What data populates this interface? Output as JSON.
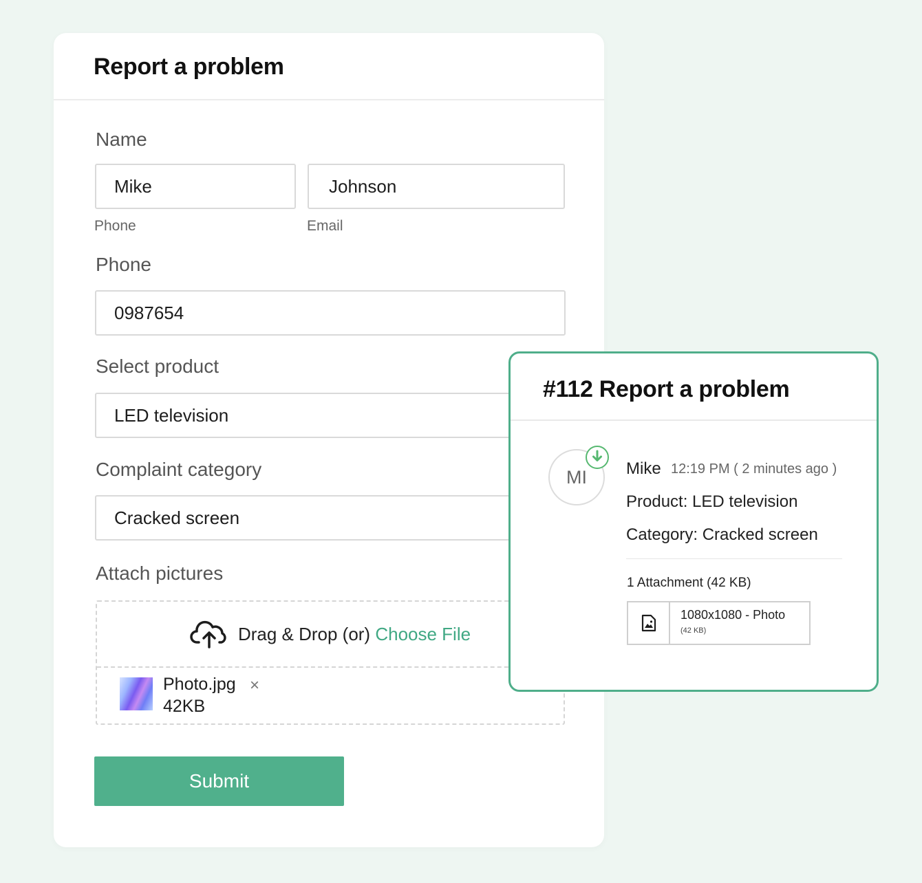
{
  "form": {
    "title": "Report a problem",
    "name_label": "Name",
    "first_name": "Mike",
    "last_name": "Johnson",
    "sub_label_left": "Phone",
    "sub_label_right": "Email",
    "phone_label": "Phone",
    "phone_value": "0987654",
    "product_label": "Select product",
    "product_value": "LED television",
    "category_label": "Complaint category",
    "category_value": "Cracked screen",
    "attach_label": "Attach pictures",
    "drop_text": "Drag & Drop (or)",
    "choose_file": "Choose File",
    "file_name": "Photo.jpg",
    "file_size": "42KB",
    "file_remove": "×",
    "submit_label": "Submit"
  },
  "ticket": {
    "title": "#112 Report a problem",
    "avatar_initials": "MI",
    "author": "Mike",
    "time": "12:19 PM ( 2 minutes ago )",
    "product_line": "Product: LED television",
    "category_line": "Category: Cracked screen",
    "attachment_summary": "1 Attachment (42 KB)",
    "attachment_name": "1080x1080 - Photo",
    "attachment_size": "(42 KB)"
  },
  "colors": {
    "accent": "#50b08c",
    "ticket_border": "#4fae8a",
    "background": "#eef6f2"
  },
  "icons": [
    "cloud-upload-icon",
    "image-file-icon",
    "status-arrow-icon",
    "close-icon"
  ]
}
